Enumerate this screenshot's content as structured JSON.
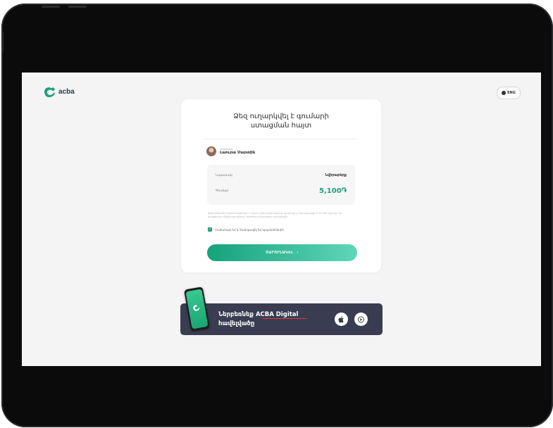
{
  "header": {
    "brand_name": "acba",
    "lang_label": "ENG"
  },
  "card": {
    "title": "Ձեզ ուղարկվել է գումարի\nստացման հայտ",
    "sender_label": "ուղարկող",
    "sender_name": "Լաուրա Մարտին",
    "rows": [
      {
        "label": "Նպատակ",
        "value": "Նվիրաբերք"
      },
      {
        "label": "Գումար",
        "value": "5,100֏"
      }
    ],
    "note": "Փոխանցման միջնորդավճարը՝ 0 դրամ, եթե փոխանցման գումարը չի գերազանցում 10 000 դրամը: Այլ դեպքերում միջնորդավճարը՝ գործող սակագների համաձայն:",
    "agree_text": "Համաձայն եմ և ծանոթացել եմ պայմաններին",
    "checkbox_checked": true,
    "continue_label": "ՇԱՐՈՒՆԱԿԵԼ"
  },
  "banner": {
    "text": "Ներբեռնեք ACBA Digital\nհավելվածը"
  },
  "colors": {
    "accent": "#1fa07a",
    "banner_bg": "#3a3d51",
    "screen_bg": "#f4f4f5"
  },
  "icons": [
    "acba-logo-icon",
    "globe-icon",
    "chevron-right-icon",
    "check-icon",
    "apple-icon",
    "play-store-icon"
  ]
}
